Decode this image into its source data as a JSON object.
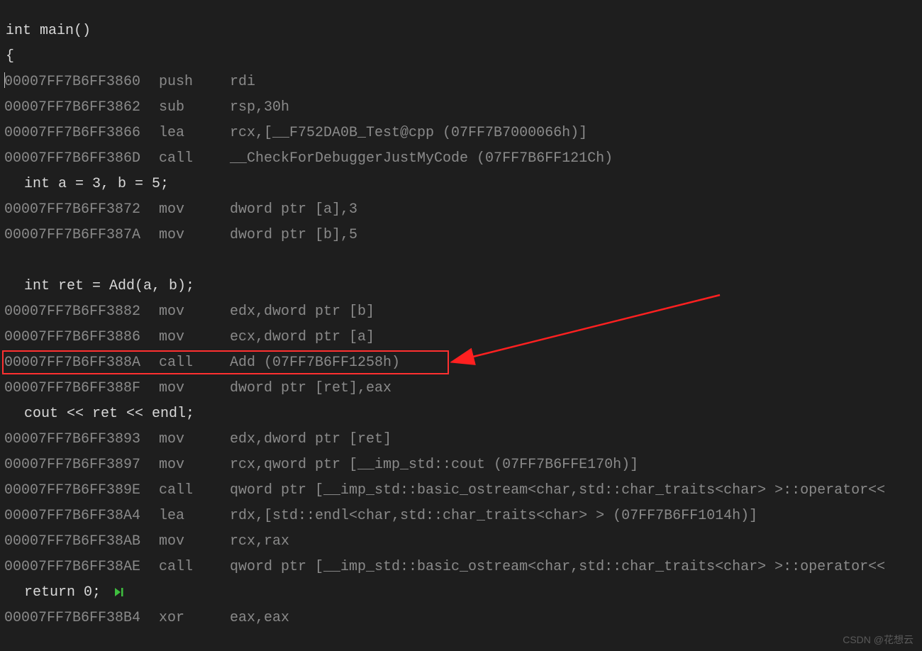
{
  "source": {
    "line1": "int main()",
    "line2": "{",
    "line3": "    int a = 3, b = 5;",
    "line4": "    int ret = Add(a, b);",
    "line5": "    cout << ret << endl;",
    "line6": "    return 0;"
  },
  "asm": {
    "r1": {
      "addr": "00007FF7B6FF3860",
      "mnem": "push",
      "ops": "rdi"
    },
    "r2": {
      "addr": "00007FF7B6FF3862",
      "mnem": "sub",
      "ops": "rsp,30h"
    },
    "r3": {
      "addr": "00007FF7B6FF3866",
      "mnem": "lea",
      "ops": "rcx,[__F752DA0B_Test@cpp (07FF7B7000066h)]"
    },
    "r4": {
      "addr": "00007FF7B6FF386D",
      "mnem": "call",
      "ops": "__CheckForDebuggerJustMyCode (07FF7B6FF121Ch)"
    },
    "r5": {
      "addr": "00007FF7B6FF3872",
      "mnem": "mov",
      "ops": "dword ptr [a],3"
    },
    "r6": {
      "addr": "00007FF7B6FF387A",
      "mnem": "mov",
      "ops": "dword ptr [b],5"
    },
    "r7": {
      "addr": "00007FF7B6FF3882",
      "mnem": "mov",
      "ops": "edx,dword ptr [b]"
    },
    "r8": {
      "addr": "00007FF7B6FF3886",
      "mnem": "mov",
      "ops": "ecx,dword ptr [a]"
    },
    "r9": {
      "addr": "00007FF7B6FF388A",
      "mnem": "call",
      "ops": "Add (07FF7B6FF1258h)"
    },
    "r10": {
      "addr": "00007FF7B6FF388F",
      "mnem": "mov",
      "ops": "dword ptr [ret],eax"
    },
    "r11": {
      "addr": "00007FF7B6FF3893",
      "mnem": "mov",
      "ops": "edx,dword ptr [ret]"
    },
    "r12": {
      "addr": "00007FF7B6FF3897",
      "mnem": "mov",
      "ops": "rcx,qword ptr [__imp_std::cout (07FF7B6FFE170h)]"
    },
    "r13": {
      "addr": "00007FF7B6FF389E",
      "mnem": "call",
      "ops": "qword ptr [__imp_std::basic_ostream<char,std::char_traits<char> >::operator<<"
    },
    "r14": {
      "addr": "00007FF7B6FF38A4",
      "mnem": "lea",
      "ops": "rdx,[std::endl<char,std::char_traits<char> > (07FF7B6FF1014h)]"
    },
    "r15": {
      "addr": "00007FF7B6FF38AB",
      "mnem": "mov",
      "ops": "rcx,rax"
    },
    "r16": {
      "addr": "00007FF7B6FF38AE",
      "mnem": "call",
      "ops": "qword ptr [__imp_std::basic_ostream<char,std::char_traits<char> >::operator<<"
    },
    "r17": {
      "addr": "00007FF7B6FF38B4",
      "mnem": "xor",
      "ops": "eax,eax"
    }
  },
  "watermark": "CSDN @花想云",
  "annotation": {
    "highlight_row": "r9",
    "highlight_box_color": "#ff3030"
  }
}
